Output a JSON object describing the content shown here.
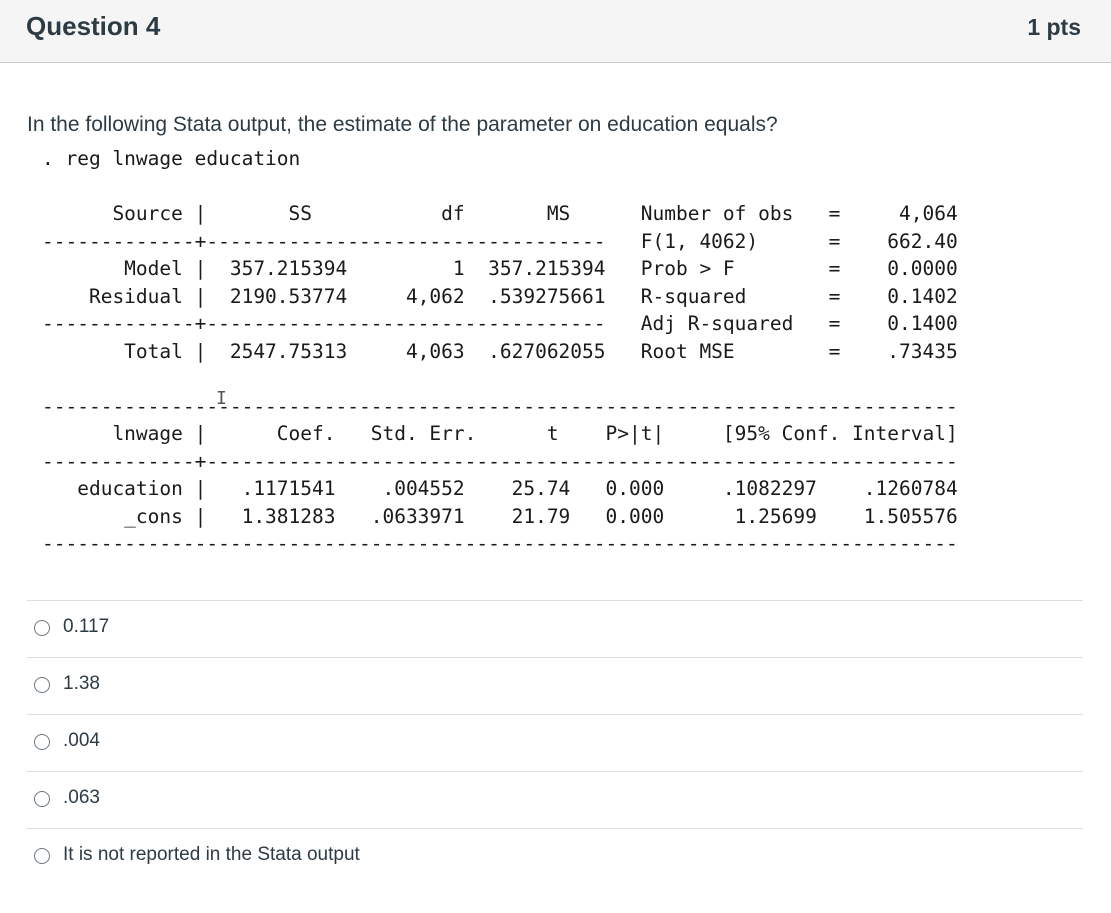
{
  "header": {
    "title": "Question 4",
    "points": "1 pts"
  },
  "question": {
    "prompt": "In the following Stata output, the estimate of the parameter on education equals?",
    "stata_output": ". reg lnwage education\n\n      Source |       SS           df       MS      Number of obs   =     4,064\n-------------+----------------------------------   F(1, 4062)      =    662.40\n       Model |  357.215394         1  357.215394   Prob > F        =    0.0000\n    Residual |  2190.53774     4,062  .539275661   R-squared       =    0.1402\n-------------+----------------------------------   Adj R-squared   =    0.1400\n       Total |  2547.75313     4,063  .627062055   Root MSE        =    .73435\n\n------------------------------------------------------------------------------\n      lnwage |      Coef.   Std. Err.      t    P>|t|     [95% Conf. Interval]\n-------------+----------------------------------------------------------------\n   education |   .1171541    .004552    25.74   0.000     .1082297    .1260784\n       _cons |   1.381283   .0633971    21.79   0.000      1.25699    1.505576\n------------------------------------------------------------------------------",
    "cursor_glyph": "I"
  },
  "answers": [
    {
      "label": "0.117"
    },
    {
      "label": "1.38"
    },
    {
      "label": ".004"
    },
    {
      "label": ".063"
    },
    {
      "label": "It is not reported in the Stata output"
    }
  ]
}
